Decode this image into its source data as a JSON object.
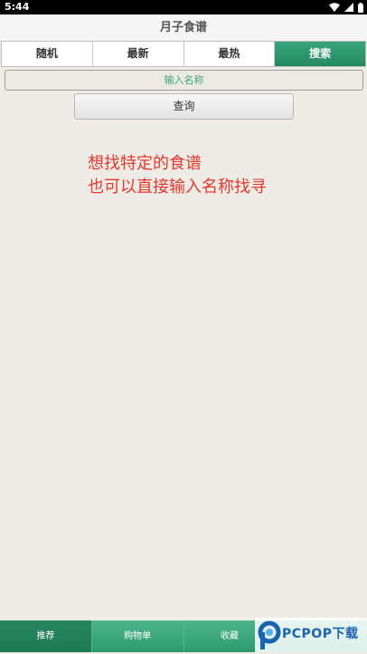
{
  "status_bar": {
    "time": "5:44"
  },
  "app": {
    "title": "月子食谱"
  },
  "tabs": [
    {
      "label": "随机",
      "active": false
    },
    {
      "label": "最新",
      "active": false
    },
    {
      "label": "最热",
      "active": false
    },
    {
      "label": "搜索",
      "active": true
    }
  ],
  "search": {
    "placeholder": "输入名称",
    "value": ""
  },
  "query_button": {
    "label": "查询"
  },
  "hint": {
    "line1": "想找特定的食谱",
    "line2": "也可以直接输入名称找寻"
  },
  "bottom_nav": [
    {
      "label": "推荐",
      "active": true
    },
    {
      "label": "购物单",
      "active": false
    },
    {
      "label": "收藏",
      "active": false
    },
    {
      "label": "",
      "active": false
    }
  ],
  "watermark": {
    "brand": "PCPOP下载"
  },
  "colors": {
    "accent": "#2f9a70",
    "hint_text": "#e8372b",
    "background": "#efebe5"
  },
  "icons": [
    "wifi-icon",
    "signal-icon",
    "battery-icon",
    "pcpop-logo-icon"
  ]
}
